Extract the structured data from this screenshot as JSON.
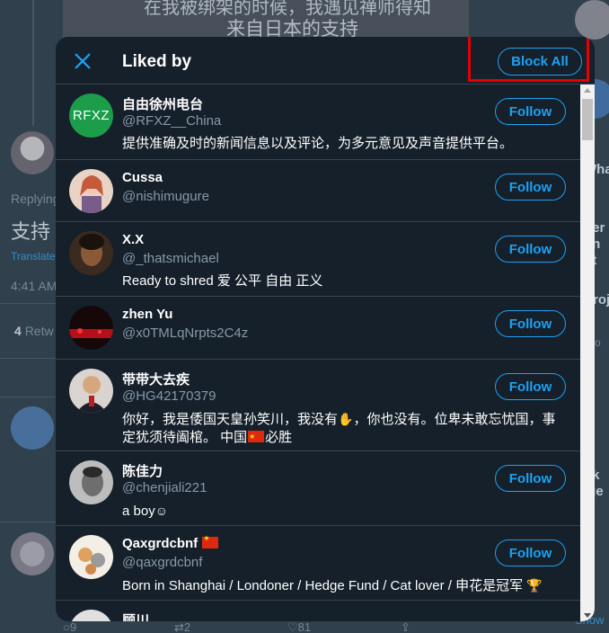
{
  "background": {
    "media_caption_line1": "在我被绑架的时候，我遇见禅师得知",
    "media_caption_line2": "来自日本的支持",
    "replying": "Replying",
    "tweet_text": "支持",
    "translate": "Translate",
    "time": "4:41 AM",
    "retweets_count": "4",
    "retweets_label": "Retw",
    "right_column": [
      "Wha",
      "ner",
      "nn",
      "ot",
      "Proj",
      "Pro",
      "ok",
      "ige"
    ],
    "actions": {
      "replies": "9",
      "retweets": "2",
      "likes": "81"
    },
    "show": "Show"
  },
  "modal": {
    "title": "Liked by",
    "block_all_label": "Block All",
    "follow_label": "Follow",
    "users": [
      {
        "name": "自由徐州电台",
        "handle": "@RFXZ__China",
        "bio": "提供准确及时的新闻信息以及评论，为多元意见及声音提供平台。",
        "avatar_text": "RFXZ",
        "avatar_color": "#1b9d4a"
      },
      {
        "name": "Cussa",
        "handle": "@nishimugure",
        "bio": "",
        "avatar_text": "",
        "avatar_color": "#e9d3c4"
      },
      {
        "name": "X.X",
        "handle": "@_thatsmichael",
        "bio": "Ready to shred 爱 公平 自由 正义",
        "avatar_text": "",
        "avatar_color": "#3a2a20"
      },
      {
        "name": "zhen Yu",
        "handle": "@x0TMLqNrpts2C4z",
        "bio": "",
        "avatar_text": "",
        "avatar_color": "#1a0a0a"
      },
      {
        "name": "带带大去疾",
        "handle": "@HG42170379",
        "bio_part1": "你好，我是倭国天皇孙笑川，我没有",
        "bio_part2": "，你也没有。位卑未敢忘忧国，事定犹须待阖棺。 中国",
        "bio_part3": "必胜",
        "avatar_text": "",
        "avatar_color": "#d9d4cf"
      },
      {
        "name": "陈佳力",
        "handle": "@chenjiali221",
        "bio": "a boy",
        "avatar_text": "",
        "avatar_color": "#bdbdbd"
      },
      {
        "name": "Qaxgrdcbnf",
        "handle": "@qaxgrdcbnf",
        "bio": "Born in Shanghai / Londoner / Hedge Fund / Cat lover / 申花是冠军",
        "avatar_text": "",
        "avatar_color": "#f3efe6"
      },
      {
        "name": "顾川",
        "handle": "",
        "bio": "",
        "avatar_text": "",
        "avatar_color": "#e0e0e0"
      }
    ]
  }
}
